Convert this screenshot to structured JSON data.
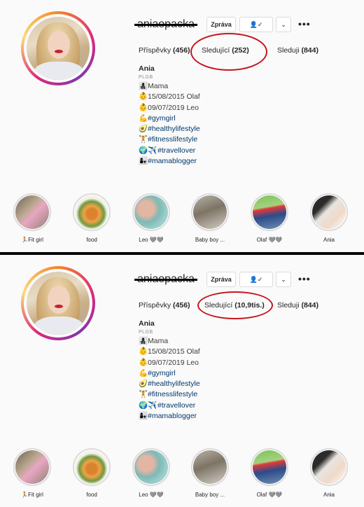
{
  "profiles": [
    {
      "username": "aniaopacka",
      "buttons": {
        "message": "Zpráva",
        "follow_icon": "👤✓",
        "more_icon": "⌄",
        "options": "•••"
      },
      "stats": {
        "posts_label": "Příspěvky",
        "posts_value": "(456)",
        "followers_label": "Sledující",
        "followers_value": "(252)",
        "following_label": "Sleduji",
        "following_value": "(844)"
      },
      "bio": {
        "name": "Ania",
        "category": "PLGB",
        "lines": [
          {
            "emoji": "👩‍👧‍👦",
            "text": "Mama"
          },
          {
            "emoji": "👶",
            "text": "15/08/2015 Olaf"
          },
          {
            "emoji": "👶",
            "text": "09/07/2019 Leo"
          },
          {
            "emoji": "💪",
            "text": "#gymgirl"
          },
          {
            "emoji": "🥑",
            "text": "#healthylifestyle"
          },
          {
            "emoji": "🏋",
            "text": "#fitnesslifestyle"
          },
          {
            "emoji": "🌍✈️",
            "text": "#travellover"
          },
          {
            "emoji": "👩‍👧",
            "text": "#mamablogger"
          }
        ]
      },
      "highlights": [
        {
          "label": "🏃Fit girl"
        },
        {
          "label": "food"
        },
        {
          "label": "Leo 🩶🩶"
        },
        {
          "label": "Baby boy ..."
        },
        {
          "label": "Olaf 🩶🩶"
        },
        {
          "label": "Ania"
        }
      ]
    },
    {
      "username": "aniaopacka",
      "buttons": {
        "message": "Zpráva",
        "follow_icon": "👤✓",
        "more_icon": "⌄",
        "options": "•••"
      },
      "stats": {
        "posts_label": "Příspěvky",
        "posts_value": "(456)",
        "followers_label": "Sledující",
        "followers_value": "(10,9tis.)",
        "following_label": "Sleduji",
        "following_value": "(844)"
      },
      "bio": {
        "name": "Ania",
        "category": "PLGB",
        "lines": [
          {
            "emoji": "👩‍👧‍👦",
            "text": "Mama"
          },
          {
            "emoji": "👶",
            "text": "15/08/2015 Olaf"
          },
          {
            "emoji": "👶",
            "text": "09/07/2019 Leo"
          },
          {
            "emoji": "💪",
            "text": "#gymgirl"
          },
          {
            "emoji": "🥑",
            "text": "#healthylifestyle"
          },
          {
            "emoji": "🏋",
            "text": "#fitnesslifestyle"
          },
          {
            "emoji": "🌍✈️",
            "text": "#travellover"
          },
          {
            "emoji": "👩‍👧",
            "text": "#mamablogger"
          }
        ]
      },
      "highlights": [
        {
          "label": "🏃Fit girl"
        },
        {
          "label": "food"
        },
        {
          "label": "Leo 🩶🩶"
        },
        {
          "label": "Baby boy ..."
        },
        {
          "label": "Olaf 🩶🩶"
        },
        {
          "label": "Ania"
        }
      ]
    }
  ],
  "colors": {
    "annotation_circle": "#c8141e",
    "hashtag": "#00376b",
    "divider": "#000000"
  }
}
